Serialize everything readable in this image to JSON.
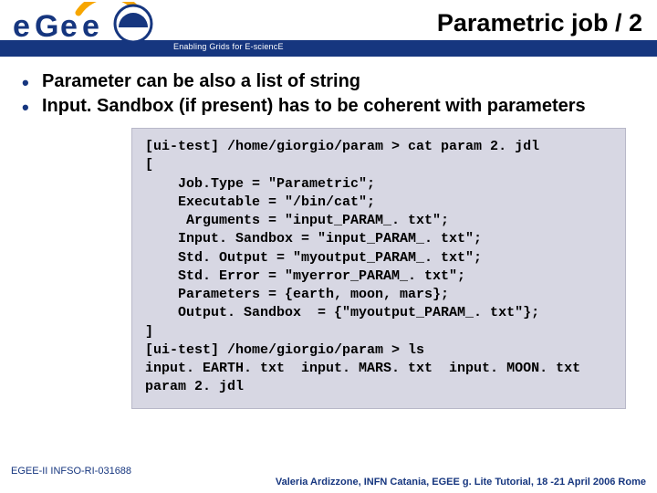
{
  "header": {
    "title": "Parametric job / 2",
    "tagline": "Enabling Grids for E-sciencE",
    "logo_text_e": "e",
    "logo_text_gee": "Gee"
  },
  "bullets": [
    "Parameter can be also a list of string",
    "Input. Sandbox (if present) has to be coherent with parameters"
  ],
  "code": "[ui-test] /home/giorgio/param > cat param 2. jdl\n[\n    Job.Type = \"Parametric\";\n    Executable = \"/bin/cat\";\n     Arguments = \"input_PARAM_. txt\";\n    Input. Sandbox = \"input_PARAM_. txt\";\n    Std. Output = \"myoutput_PARAM_. txt\";\n    Std. Error = \"myerror_PARAM_. txt\";\n    Parameters = {earth, moon, mars};\n    Output. Sandbox  = {\"myoutput_PARAM_. txt\"};\n]\n[ui-test] /home/giorgio/param > ls\ninput. EARTH. txt  input. MARS. txt  input. MOON. txt\nparam 2. jdl",
  "footer": {
    "left": "EGEE-II INFSO-RI-031688",
    "right": "Valeria Ardizzone, INFN Catania, EGEE g. Lite Tutorial, 18 -21 April 2006 Rome"
  }
}
